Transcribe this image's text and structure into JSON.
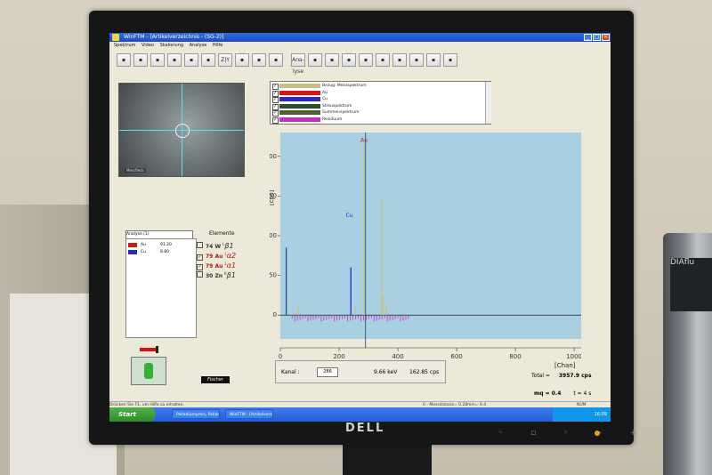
{
  "window": {
    "title": "WinFTM - [Artikelverzeichnis - (SG-2)]",
    "menu": [
      "Spektrum",
      "Video",
      "Skalierung",
      "Analyse",
      "Hilfe"
    ],
    "controls": [
      "_",
      "□",
      "×"
    ]
  },
  "toolbar": {
    "buttons": [
      "zoom-icon",
      "open-icon",
      "save-icon",
      "wrench-icon",
      "print-icon",
      "spectrum-icon",
      "zoom-z-icon",
      "z-bar-icon",
      "bar-icon",
      "view-icon",
      "analyse-icon",
      "people-icon",
      "a-icon",
      "chart-icon",
      "list-icon",
      "table-icon",
      "calibration-icon",
      "fm-icon",
      "book-icon",
      "tool-icon"
    ],
    "labels": {
      "analyse": "Ana-lyse",
      "zy": "Z|Y"
    }
  },
  "spectrum_list": [
    {
      "label": "Bezug: Messspektrum",
      "color": "#c8c080",
      "checked": true
    },
    {
      "label": "Au",
      "color": "#d01818",
      "checked": true
    },
    {
      "label": "Cu",
      "color": "#2828c8",
      "checked": true
    },
    {
      "label": "Streuspektrum",
      "color": "#285030",
      "checked": true
    },
    {
      "label": "Summenspektrum",
      "color": "#506030",
      "checked": true
    },
    {
      "label": "Residuum",
      "color": "#c030c0",
      "checked": true
    }
  ],
  "preview": {
    "caption": "Messfleck"
  },
  "analysis": {
    "select_value": "Analyse (1)",
    "rows": [
      {
        "element": "Au",
        "value": "91.20",
        "color": "#d01818"
      },
      {
        "element": "Cu",
        "value": "8.80",
        "color": "#2828c8"
      }
    ]
  },
  "elements": {
    "title": "Elemente",
    "rows": [
      {
        "checked": false,
        "label": "74 W",
        "line": "β1",
        "sup": "L",
        "color": "normal"
      },
      {
        "checked": true,
        "label": "79 Au",
        "line": "α2",
        "sup": "L",
        "color": "red"
      },
      {
        "checked": true,
        "label": "79 Au",
        "line": "α1",
        "sup": "L",
        "color": "red"
      },
      {
        "checked": false,
        "label": "30 Zn",
        "line": "β1",
        "sup": "K",
        "color": "normal"
      }
    ]
  },
  "logo": "Fischer",
  "chart_data": {
    "type": "line",
    "xlabel": "[Chan]",
    "ylabel": "[cps]",
    "xlim": [
      0,
      1024
    ],
    "ylim": [
      -30,
      230
    ],
    "x_ticks": [
      0,
      200,
      400,
      600,
      800,
      1000
    ],
    "y_ticks": [
      0,
      50,
      100,
      150,
      200
    ],
    "grid": false,
    "background": "#a9d0e0",
    "peaks": [
      {
        "x": 20,
        "y": 85,
        "color": "#2a4a8a"
      },
      {
        "x": 60,
        "y": 10,
        "color": "#c8c080"
      },
      {
        "x": 240,
        "y": 60,
        "color": "#2828c8"
      },
      {
        "x": 255,
        "y": 12,
        "color": "#c8c080"
      },
      {
        "x": 285,
        "y": 215,
        "color": "#c8c080"
      },
      {
        "x": 345,
        "y": 145,
        "color": "#c8c080"
      },
      {
        "x": 350,
        "y": 25,
        "color": "#c8c080"
      },
      {
        "x": 360,
        "y": 10,
        "color": "#c8c080"
      },
      {
        "x": 420,
        "y": 6,
        "color": "#c8c080"
      }
    ],
    "annotations": [
      {
        "text": "Au",
        "x": 285,
        "y": 215,
        "color": "#d01818"
      },
      {
        "text": "Cu",
        "x": 235,
        "y": 120,
        "color": "#2828c8"
      }
    ],
    "cursor_x": 290,
    "cursor_color": "#1a3a80"
  },
  "footer": {
    "kanal_label": "Kanal :",
    "kanal_value": "286",
    "energy": "9.66 keV",
    "cps": "162.85 cps",
    "total_label": "Total =",
    "total_value": "3957.9 cps",
    "meas": "mq = 0.4",
    "time": "t = 4 s"
  },
  "status": {
    "left": "Drücken Sie F1, um Hilfe zu erhalten.",
    "mid": "0 - Messdistanz= 0.28",
    "right": "mm= 0.4",
    "num": "NUM"
  },
  "taskbar": {
    "start": "Start",
    "tasks": [
      "Palladiumpreis, Palladi...",
      "WinFTM - [Artikelverz..."
    ],
    "clock": "16:09"
  },
  "bezel": {
    "brand": "DELL",
    "side_badge": "DIAflu"
  }
}
